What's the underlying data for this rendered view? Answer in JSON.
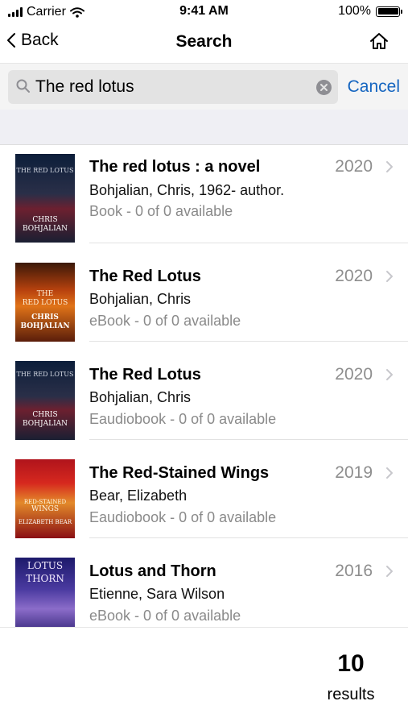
{
  "status_bar": {
    "carrier": "Carrier",
    "time": "9:41 AM",
    "battery": "100%"
  },
  "nav": {
    "back_label": "Back",
    "title": "Search"
  },
  "search": {
    "query": "The red lotus",
    "cancel_label": "Cancel"
  },
  "results": [
    {
      "title": "The red lotus : a novel",
      "author": "Bohjalian, Chris, 1962- author.",
      "format": "Book - 0 of 0 available",
      "year": "2020"
    },
    {
      "title": "The Red Lotus",
      "author": "Bohjalian, Chris",
      "format": "eBook - 0 of 0 available",
      "year": "2020"
    },
    {
      "title": "The Red Lotus",
      "author": "Bohjalian, Chris",
      "format": "Eaudiobook - 0 of 0 available",
      "year": "2020"
    },
    {
      "title": "The Red-Stained Wings",
      "author": "Bear, Elizabeth",
      "format": "Eaudiobook - 0 of 0 available",
      "year": "2019"
    },
    {
      "title": "Lotus and Thorn",
      "author": "Etienne, Sara Wilson",
      "format": "eBook - 0 of 0 available",
      "year": "2016"
    }
  ],
  "covers": [
    {
      "line1": "THE RED LOTUS",
      "line2": "CHRIS",
      "line3": "BOHJALIAN"
    },
    {
      "line1": "THE",
      "line2": "RED LOTUS",
      "line3": "CHRIS",
      "line4": "BOHJALIAN"
    },
    {
      "line1": "THE RED LOTUS",
      "line2": "CHRIS",
      "line3": "BOHJALIAN"
    },
    {
      "line1": "RED-STAINED",
      "line2": "WINGS",
      "line3": "ELIZABETH BEAR"
    },
    {
      "line1": "LOTUS",
      "line2": "THORN"
    }
  ],
  "footer": {
    "count": "10",
    "count_label": "results"
  },
  "colors": {
    "accent": "#1565c0",
    "secondary_text": "#8a8a8a",
    "band": "#efeff4"
  }
}
